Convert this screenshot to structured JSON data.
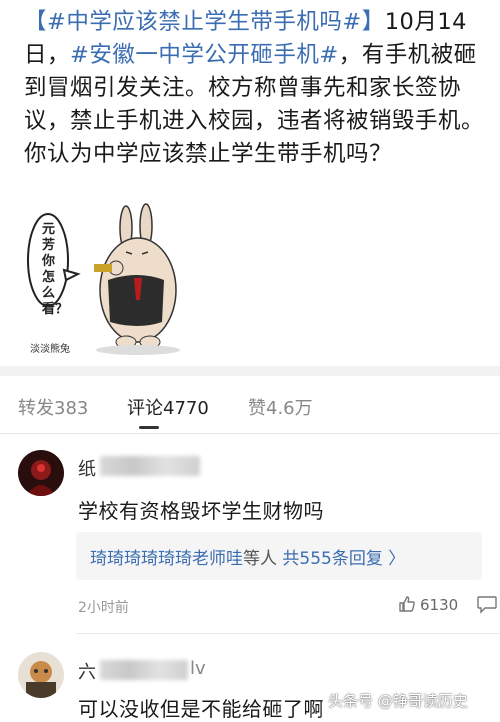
{
  "post": {
    "hashtag1": "【#中学应该禁止学生带手机吗#】",
    "date": "10月14日，",
    "hashtag2": "#安徽一中学公开砸手机#",
    "body": "，有手机被砸到冒烟引发关注。校方称曾事先和家长签协议，禁止手机进入校园，违者将被销毁手机。你认为中学应该禁止学生带手机吗？",
    "sticker_bubble": "元芳你怎么看？",
    "sticker_sign": "淡淡熊兔"
  },
  "tabs": {
    "repost": "转发383",
    "comments": "评论4770",
    "likes": "赞4.6万"
  },
  "comment1": {
    "username_visible": "纸",
    "text": "学校有资格毁坏学生财物吗",
    "reply_names": "琦琦琦琦琦琦老师哇",
    "reply_wait": "等人",
    "reply_count": "共555条回复",
    "reply_arrow": "〉",
    "time": "2小时前",
    "likes": "6130"
  },
  "comment2": {
    "username_visible": "六",
    "username_tail": "lv",
    "text": "可以没收但是不能给砸了啊"
  },
  "watermark": "头条号 @铮哥读历史",
  "colors": {
    "link": "#3b6db2",
    "divider": "#f2f2f2",
    "muted": "#999999"
  }
}
